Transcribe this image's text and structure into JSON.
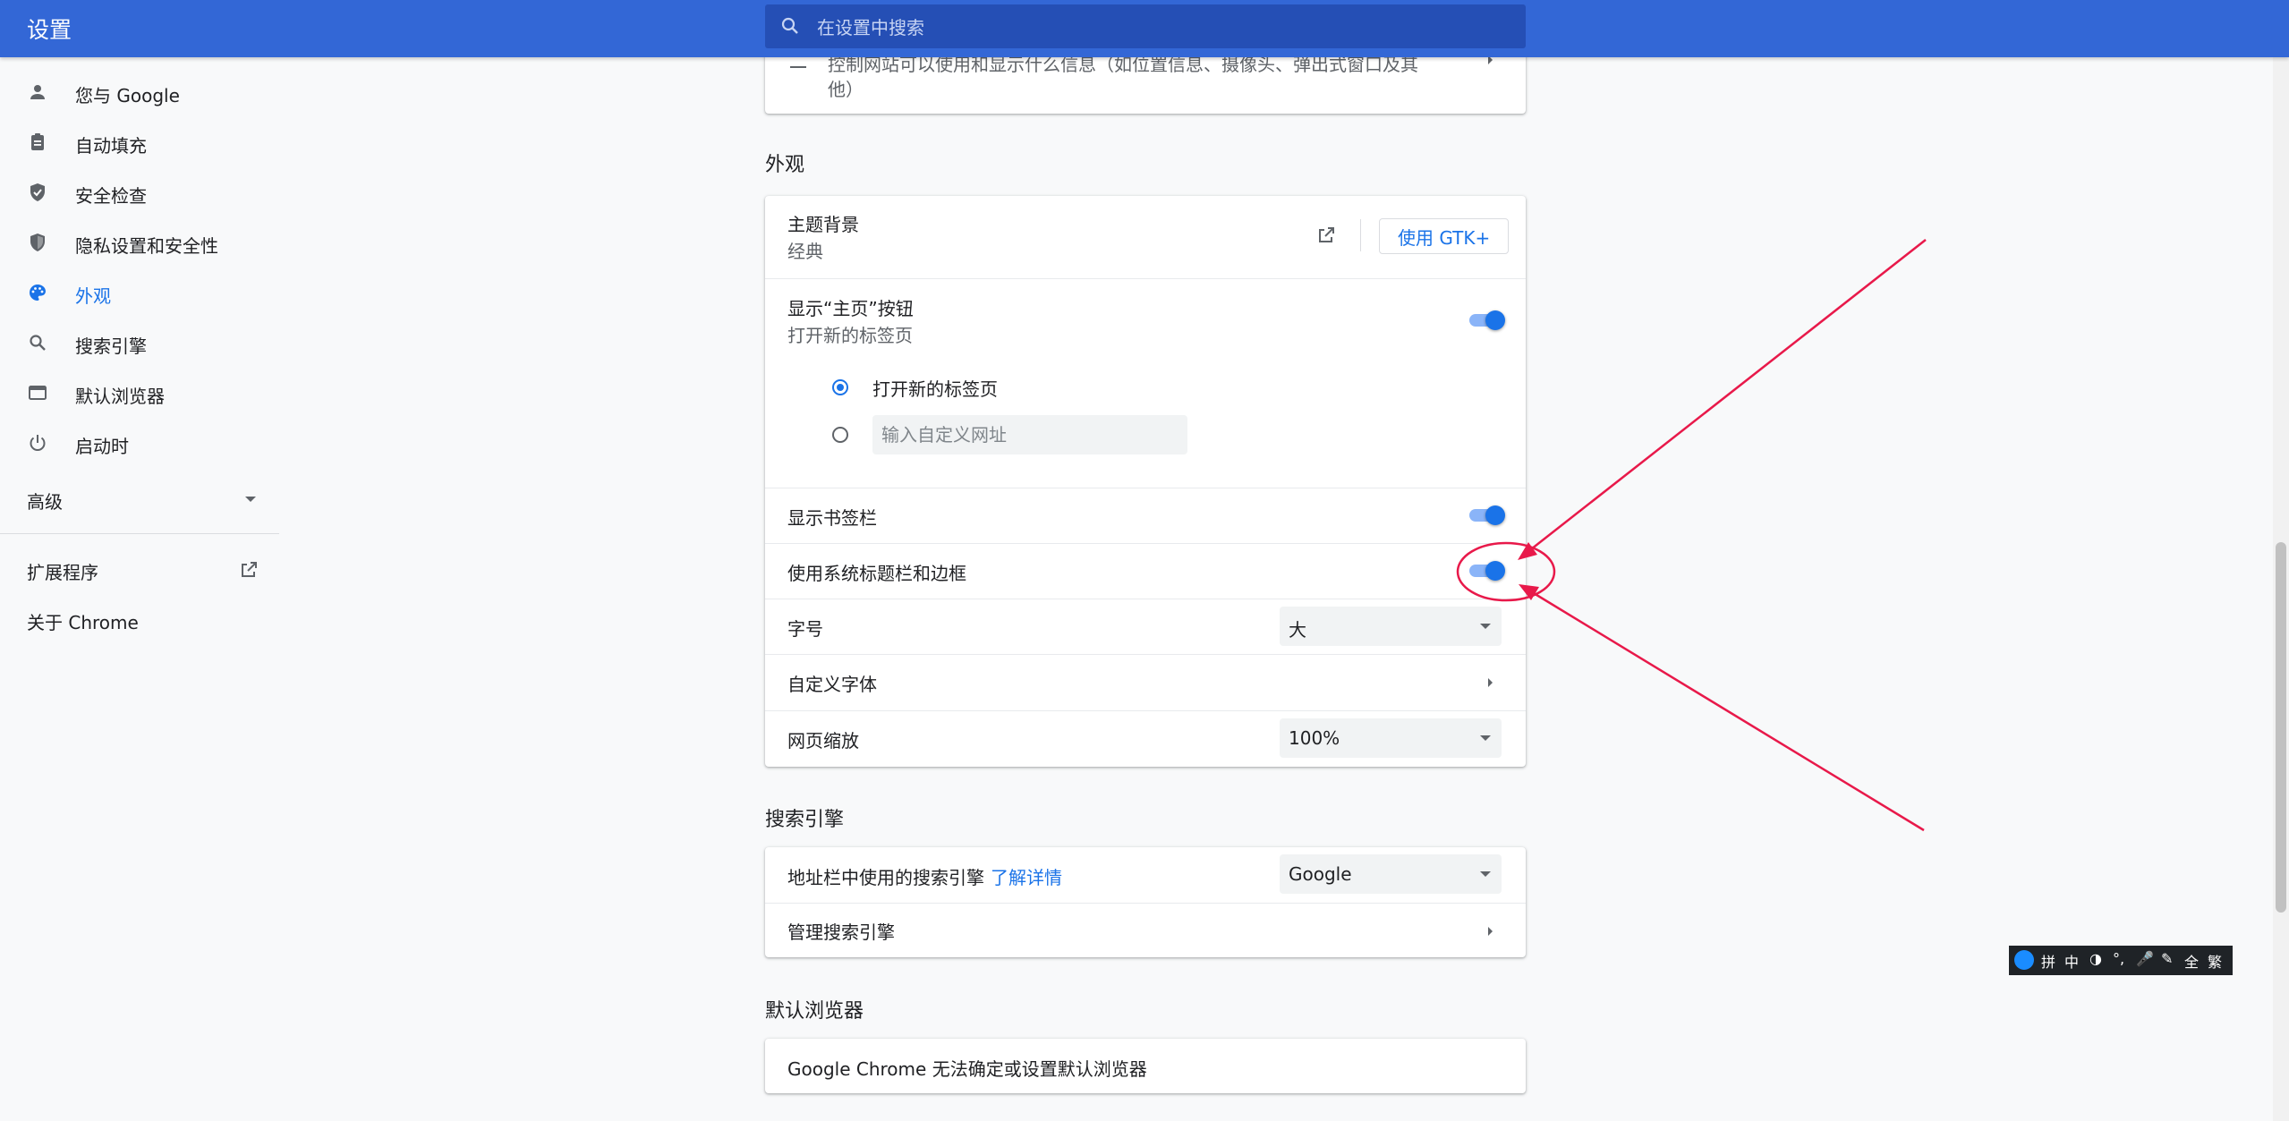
{
  "header": {
    "title": "设置",
    "search_placeholder": "在设置中搜索"
  },
  "sidebar": {
    "items": [
      {
        "label": "您与 Google",
        "icon": "person-icon"
      },
      {
        "label": "自动填充",
        "icon": "clipboard-icon"
      },
      {
        "label": "安全检查",
        "icon": "shield-check-icon"
      },
      {
        "label": "隐私设置和安全性",
        "icon": "shield-icon"
      },
      {
        "label": "外观",
        "icon": "palette-icon",
        "active": true
      },
      {
        "label": "搜索引擎",
        "icon": "search-icon"
      },
      {
        "label": "默认浏览器",
        "icon": "browser-icon"
      },
      {
        "label": "启动时",
        "icon": "power-icon"
      }
    ],
    "advanced": "高级",
    "extensions": "扩展程序",
    "about": "关于 Chrome"
  },
  "privacy_tail": {
    "line1": "控制网站可以使用和显示什么信息（如位置信息、摄像头、弹出式窗口及其",
    "line2": "他）"
  },
  "appearance": {
    "title": "外观",
    "theme_label": "主题背景",
    "theme_value": "经典",
    "gtk_button": "使用 GTK+",
    "home_button_label": "显示“主页”按钮",
    "home_button_sub": "打开新的标签页",
    "home_button_on": true,
    "radio_newtab": "打开新的标签页",
    "custom_url_placeholder": "输入自定义网址",
    "bookmarks_bar": "显示书签栏",
    "bookmarks_bar_on": true,
    "system_titlebar": "使用系统标题栏和边框",
    "system_titlebar_on": true,
    "font_size_label": "字号",
    "font_size_value": "大",
    "custom_fonts": "自定义字体",
    "page_zoom_label": "网页缩放",
    "page_zoom_value": "100%"
  },
  "search_engine": {
    "title": "搜索引擎",
    "label": "地址栏中使用的搜索引擎",
    "learn_more": "了解详情",
    "value": "Google",
    "manage": "管理搜索引擎"
  },
  "default_browser": {
    "title": "默认浏览器",
    "text": "Google Chrome 无法确定或设置默认浏览器"
  },
  "ime_toolbar": {
    "items": [
      "拼",
      "中",
      "◑",
      "°,",
      "🎤",
      "✎",
      "全",
      "繁"
    ]
  },
  "colors": {
    "header": "#3367d6",
    "accent": "#1a73e8",
    "annotation": "#e8194a"
  }
}
